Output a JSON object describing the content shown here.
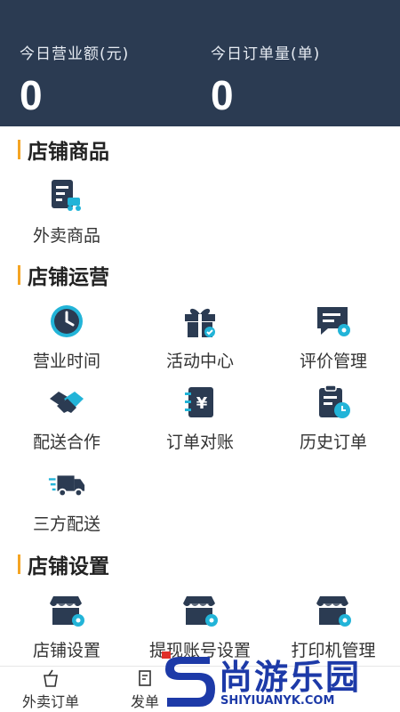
{
  "header": {
    "revenue_label": "今日营业额(元)",
    "revenue_value": "0",
    "orders_label": "今日订单量(单)",
    "orders_value": "0"
  },
  "sections": {
    "goods": {
      "title": "店铺商品",
      "items": [
        {
          "label": "外卖商品",
          "icon": "takeout-goods-icon"
        }
      ]
    },
    "operations": {
      "title": "店铺运营",
      "items": [
        {
          "label": "营业时间",
          "icon": "clock-icon"
        },
        {
          "label": "活动中心",
          "icon": "gift-icon"
        },
        {
          "label": "评价管理",
          "icon": "review-icon"
        },
        {
          "label": "配送合作",
          "icon": "handshake-icon"
        },
        {
          "label": "订单对账",
          "icon": "yen-ledger-icon"
        },
        {
          "label": "历史订单",
          "icon": "history-clipboard-icon"
        },
        {
          "label": "三方配送",
          "icon": "delivery-truck-icon"
        }
      ]
    },
    "settings": {
      "title": "店铺设置",
      "items": [
        {
          "label": "店铺设置",
          "icon": "store-gear-icon"
        },
        {
          "label": "提现账号设置",
          "icon": "store-gear-icon"
        },
        {
          "label": "打印机管理",
          "icon": "store-gear-icon"
        }
      ]
    }
  },
  "bottom_nav": [
    {
      "label": "外卖订单",
      "icon": "takeout-order-icon"
    },
    {
      "label": "发单",
      "icon": "send-order-icon"
    }
  ],
  "watermark": {
    "cn": "尚游乐园",
    "en": "SHIYIUANYK.COM"
  },
  "colors": {
    "header_bg": "#2b3b52",
    "icon_dark": "#2b3b52",
    "icon_accent": "#22b4d8",
    "section_bar": "#f5a524",
    "watermark": "#1d3aa8"
  }
}
